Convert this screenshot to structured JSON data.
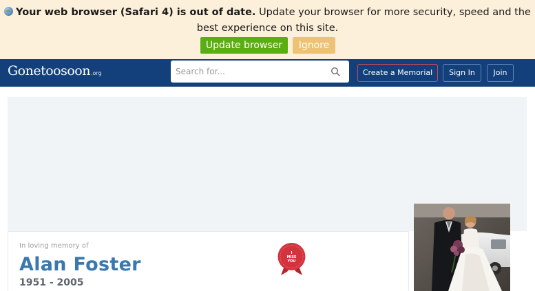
{
  "banner": {
    "title_bold": "Your web browser (Safari 4) is out of date.",
    "message_part1": "Update your browser for more security, speed and the",
    "message_part2": "best experience on this site.",
    "update_label": "Update browser",
    "ignore_label": "Ignore",
    "icon": "globe-icon"
  },
  "header": {
    "logo_main": "Gonetoosoon",
    "logo_tld": ".org",
    "search_placeholder": "Search for...",
    "create_label": "Create a Memorial",
    "signin_label": "Sign In",
    "join_label": "Join"
  },
  "memorial": {
    "memory_label": "In loving memory of",
    "name": "Alan Foster",
    "dates": "1951 - 2005",
    "badge_line1": "I",
    "badge_line2": "MISS",
    "badge_line3": "YOU"
  },
  "colors": {
    "banner_bg": "#fcf0db",
    "nav_bg": "#13407b",
    "update_button": "#5aad12",
    "ignore_button": "#edc274",
    "name_blue": "#3a78ad",
    "badge_red": "#d3333d"
  }
}
